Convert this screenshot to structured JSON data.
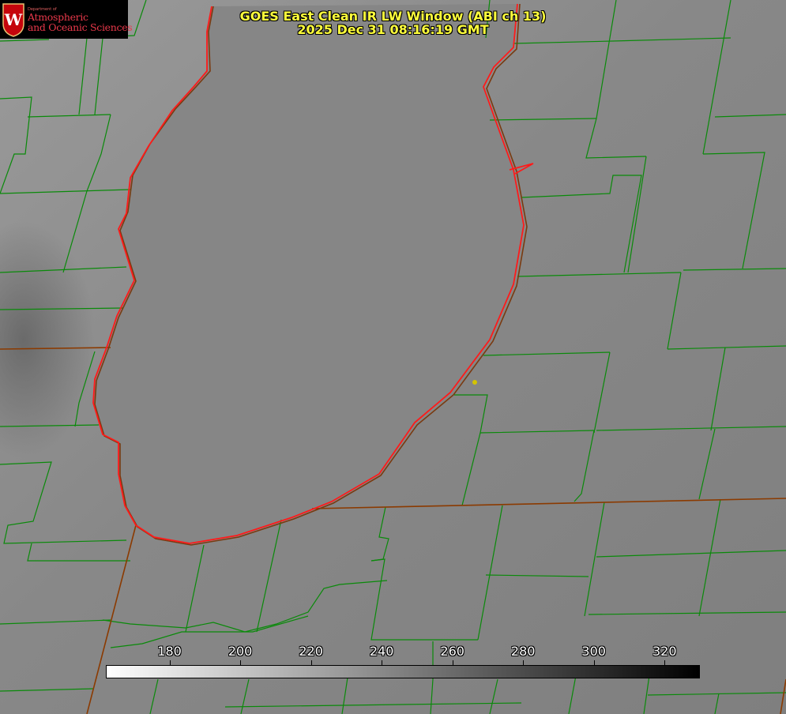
{
  "title": {
    "line1": "GOES East Clean IR LW Window (ABI ch 13)",
    "line2": "2025 Dec 31 08:16:19 GMT"
  },
  "logo": {
    "dept": "Department of",
    "line1": "Atmospheric",
    "line2": "and Oceanic Sciences",
    "icon": "crest-w-icon"
  },
  "colorbar": {
    "min": 162,
    "max": 330,
    "gradient_start_color": "#ffffff",
    "gradient_end_color": "#000000",
    "ticks": [
      {
        "value": 180,
        "label": "180"
      },
      {
        "value": 200,
        "label": "200"
      },
      {
        "value": 220,
        "label": "220"
      },
      {
        "value": 240,
        "label": "240"
      },
      {
        "value": 260,
        "label": "260"
      },
      {
        "value": 280,
        "label": "280"
      },
      {
        "value": 300,
        "label": "300"
      },
      {
        "value": 320,
        "label": "320"
      }
    ]
  },
  "colors": {
    "county_lines": "#0a8a0a",
    "state_lines": "#8b3a00",
    "lake_outline": "#ff1a1a",
    "station_marker": "#d4c400",
    "title_text": "#ffff3c"
  }
}
